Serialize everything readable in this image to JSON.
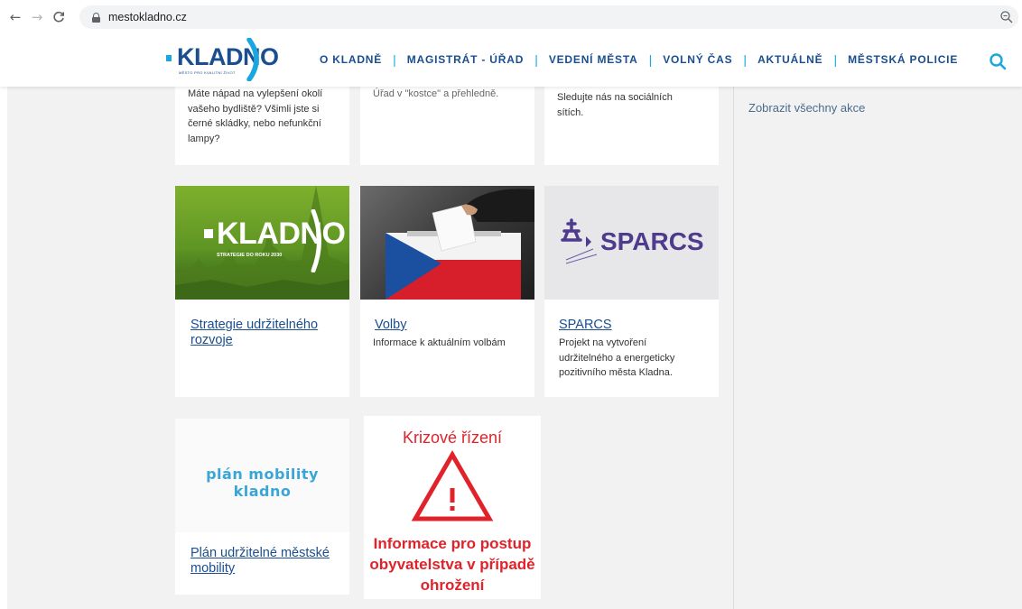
{
  "browser": {
    "url": "mestokladno.cz"
  },
  "header": {
    "logo_text": "KLADNO",
    "logo_subtitle": "MĚSTO PRO KVALITNÍ ŽIVOT",
    "nav": [
      "O KLADNĚ",
      "MAGISTRÁT - ÚŘAD",
      "VEDENÍ MĚSTA",
      "VOLNÝ ČAS",
      "AKTUÁLNĚ",
      "MĚSTSKÁ POLICIE"
    ],
    "accent_color": "#1aa7e0",
    "brand_color": "#1a4e8f"
  },
  "sidebar": {
    "events_link": "Zobrazit všechny akce"
  },
  "top_cards": [
    {
      "text": "Máte nápad na vylepšení okolí vašeho bydliště? Všimli jste si černé skládky, nebo nefunkční lampy?"
    },
    {
      "text": "Úřad v \"kostce\" a přehledně."
    },
    {
      "text": "Sledujte nás na sociálních sítích."
    }
  ],
  "cards": [
    {
      "title": "Strategie udržitelného rozvoje",
      "text": "",
      "image_logo": "KLADNO",
      "image_subtitle": "STRATEGIE DO ROKU 2030"
    },
    {
      "title": "Volby",
      "text": "Informace k aktuálním volbám"
    },
    {
      "title": "SPARCS",
      "text": "Projekt na vytvoření udržitelného a energeticky pozitivního města Kladna.",
      "image_logo": "SPARCS"
    },
    {
      "title": "Plán udržitelné městské mobility",
      "text": "",
      "image_logo": "plán mobility kladno"
    }
  ],
  "crisis": {
    "title": "Krizové řízení",
    "info": "Informace pro postup obyvatelstva v případě ohrožení",
    "color": "#e0232a"
  }
}
